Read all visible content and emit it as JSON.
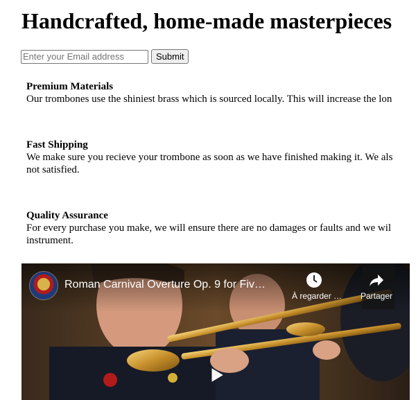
{
  "header": {
    "title": "Handcrafted, home-made masterpieces"
  },
  "form": {
    "email_placeholder": "Enter your Email address",
    "submit_label": "Submit"
  },
  "features": [
    {
      "title": "Premium Materials",
      "text": "Our trombones use the shiniest brass which is sourced locally. This will increase the lon"
    },
    {
      "title": "Fast Shipping",
      "text": "We make sure you recieve your trombone as soon as we have finished making it. We als\nnot satisfied."
    },
    {
      "title": "Quality Assurance",
      "text": "For every purchase you make, we will ensure there are no damages or faults and we wil\ninstrument."
    }
  ],
  "video": {
    "title": "Roman Carnival Overture Op. 9 for Fiv…",
    "watch_later_label": "À regarder …",
    "share_label": "Partager",
    "icons": {
      "watch_later": "clock-icon",
      "share": "share-arrow-icon",
      "play": "play-icon",
      "channel": "channel-logo"
    }
  }
}
